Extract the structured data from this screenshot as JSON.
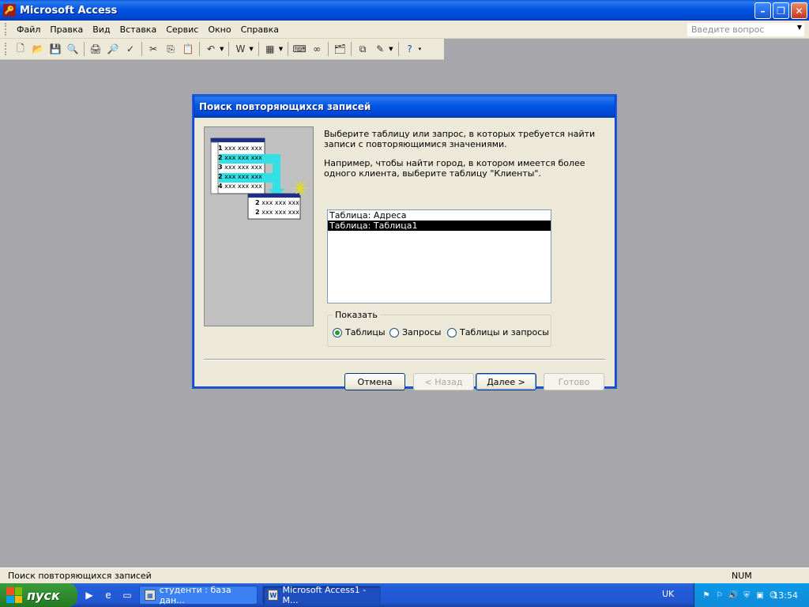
{
  "window": {
    "title": "Microsoft Access"
  },
  "menu": {
    "items": [
      "Файл",
      "Правка",
      "Вид",
      "Вставка",
      "Сервис",
      "Окно",
      "Справка"
    ],
    "help_placeholder": "Введите вопрос"
  },
  "toolbar": {
    "icons": [
      "new-icon",
      "open-icon",
      "save-icon",
      "file-search-icon",
      "print-icon",
      "print-preview-icon",
      "spelling-icon",
      "cut-icon",
      "copy-icon",
      "paste-icon",
      "undo-icon",
      "office-links-icon",
      "analyze-icon",
      "code-icon",
      "script-icon",
      "properties-icon",
      "relationships-icon",
      "new-object-icon",
      "help-icon"
    ]
  },
  "dialog": {
    "title": "Поиск повторяющихся записей",
    "instruction1": "Выберите таблицу или запрос, в которых требуется найти записи с повторяющимися значениями.",
    "instruction2": "Например, чтобы найти город, в котором имеется более одного клиента, выберите таблицу \"Клиенты\".",
    "list": {
      "items": [
        "Таблица: Адреса",
        "Таблица: Таблица1"
      ],
      "selected": "Таблица: Таблица1"
    },
    "show_group": {
      "label": "Показать",
      "options": [
        "Таблицы",
        "Запросы",
        "Таблицы и запросы"
      ],
      "selected": "Таблицы"
    },
    "illustration": {
      "top_rows": [
        "1",
        "2",
        "3",
        "2",
        "4"
      ],
      "bottom_rows": [
        "2",
        "2"
      ],
      "cell_text": "xxx xxx xxx"
    },
    "buttons": {
      "cancel": "Отмена",
      "back": "< Назад",
      "next": "Далее >",
      "finish": "Готово"
    }
  },
  "status": {
    "text": "Поиск повторяющихся записей",
    "num": "NUM"
  },
  "taskbar": {
    "start": "пуск",
    "tasks": [
      "студенти : база дан...",
      "Microsoft Access1 - M..."
    ],
    "language": "UK",
    "clock": "13:54"
  }
}
